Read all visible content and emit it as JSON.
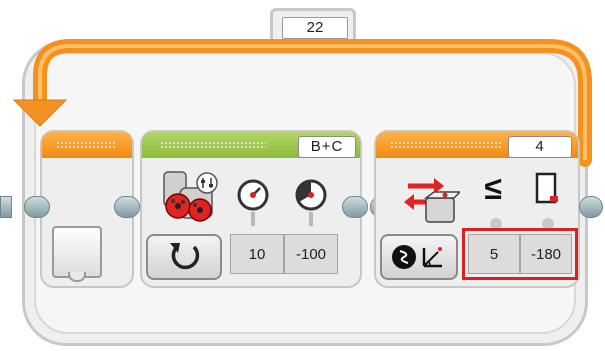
{
  "loop": {
    "name_label": "22"
  },
  "blocks": {
    "move_tank": {
      "ports_label": "B+C",
      "power_left": "10",
      "power_right": "-100"
    },
    "gyro_wait": {
      "port_label": "4",
      "comparison_symbol": "≤",
      "threshold": "5",
      "angle": "-180"
    }
  },
  "colors": {
    "loop_orange": "#f39220",
    "move_green": "#8dbb3a",
    "highlight_red": "#e02020"
  }
}
